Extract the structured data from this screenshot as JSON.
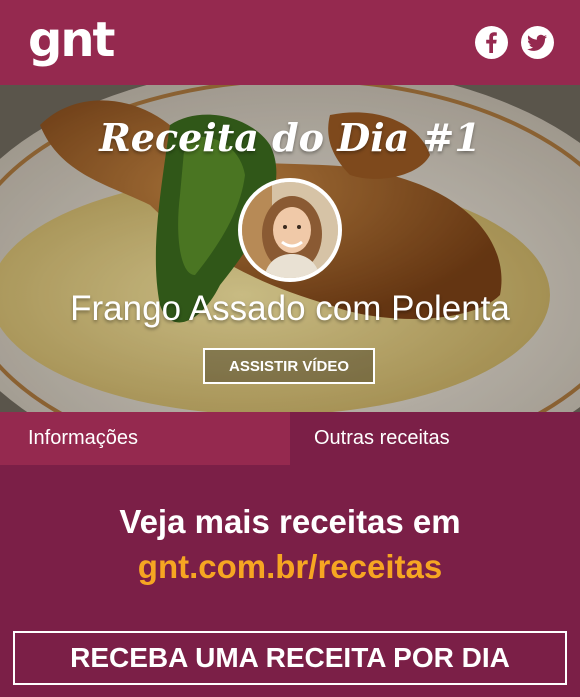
{
  "header": {
    "logo_text": "gnt",
    "facebook_icon": "facebook-icon",
    "twitter_icon": "twitter-icon"
  },
  "hero": {
    "title": "Receita do Dia #1",
    "recipe_name": "Frango Assado com Polenta",
    "watch_button": "ASSISTIR VÍDEO"
  },
  "tabs": [
    {
      "label": "Informações",
      "color": "#95294f"
    },
    {
      "label": "Outras receitas",
      "color": "#7b1f47"
    }
  ],
  "promo": {
    "line1": "Veja mais receitas em",
    "link": "gnt.com.br/receitas",
    "link_color": "#f6a622"
  },
  "subscribe_button": "RECEBA UMA RECEITA POR DIA",
  "colors": {
    "header": "#95294f",
    "panel": "#7b1f47",
    "accent": "#f6a622"
  }
}
